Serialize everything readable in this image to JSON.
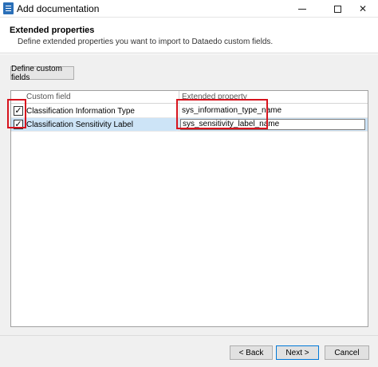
{
  "window": {
    "title": "Add documentation"
  },
  "header": {
    "title": "Extended properties",
    "subtitle": "Define extended properties you want to import to Dataedo custom fields."
  },
  "toolbar": {
    "define_label": "Define custom fields"
  },
  "grid": {
    "columns": [
      "Custom field",
      "Extended property"
    ],
    "rows": [
      {
        "checked": true,
        "field": "Classification Information Type",
        "property": "sys_information_type_name"
      },
      {
        "checked": true,
        "field": "Classification Sensitivity Label",
        "property": "sys_sensitivity_label_name"
      }
    ]
  },
  "footer": {
    "back_label": "< Back",
    "next_label": "Next >",
    "cancel_label": "Cancel"
  },
  "colors": {
    "highlight": "#d7141e",
    "selected_row": "#cde4f7"
  }
}
